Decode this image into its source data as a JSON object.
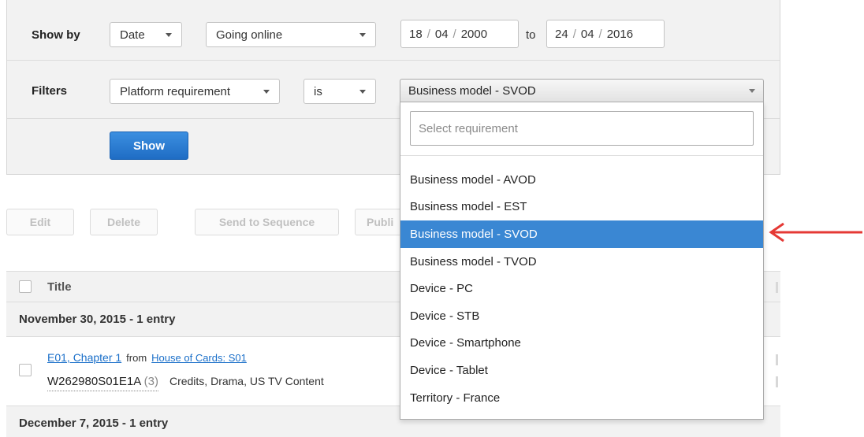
{
  "filter_panel": {
    "show_by": {
      "label": "Show by",
      "date_select": "Date",
      "event_select": "Going online",
      "from": {
        "day": "18",
        "month": "04",
        "year": "2000"
      },
      "to_label": "to",
      "to": {
        "day": "24",
        "month": "04",
        "year": "2016"
      },
      "date_separator": "/"
    },
    "filters": {
      "label": "Filters",
      "field_select": "Platform requirement",
      "operator_select": "is",
      "value_select": "Business model - SVOD"
    },
    "show_button": "Show"
  },
  "toolbar": {
    "edit": "Edit",
    "delete": "Delete",
    "send_to_sequence": "Send to Sequence",
    "publish_partial": "Publi"
  },
  "table": {
    "header_title": "Title",
    "groups": [
      {
        "label": "November 30, 2015 - 1 entry"
      },
      {
        "label": "December 7, 2015 - 1 entry"
      }
    ],
    "entries": [
      {
        "episode_link": "E01, Chapter 1",
        "from_text": "from",
        "series_link": "House of Cards: S01",
        "code": "W262980S01E1A",
        "count": "(3)",
        "tags": "Credits, Drama, US TV Content"
      }
    ]
  },
  "dropdown": {
    "search_placeholder": "Select requirement",
    "options": [
      "Business model - AVOD",
      "Business model - EST",
      "Business model - SVOD",
      "Business model - TVOD",
      "Device - PC",
      "Device - STB",
      "Device - Smartphone",
      "Device - Tablet",
      "Territory - France"
    ],
    "selected_index": 2
  },
  "colors": {
    "selected_bg": "#3a87d3",
    "primary_button": "#2a7dd4",
    "link": "#1a6fc9",
    "annotation_arrow": "#e53935"
  },
  "annotation": {
    "arrow_icon": "left-arrow-icon"
  }
}
